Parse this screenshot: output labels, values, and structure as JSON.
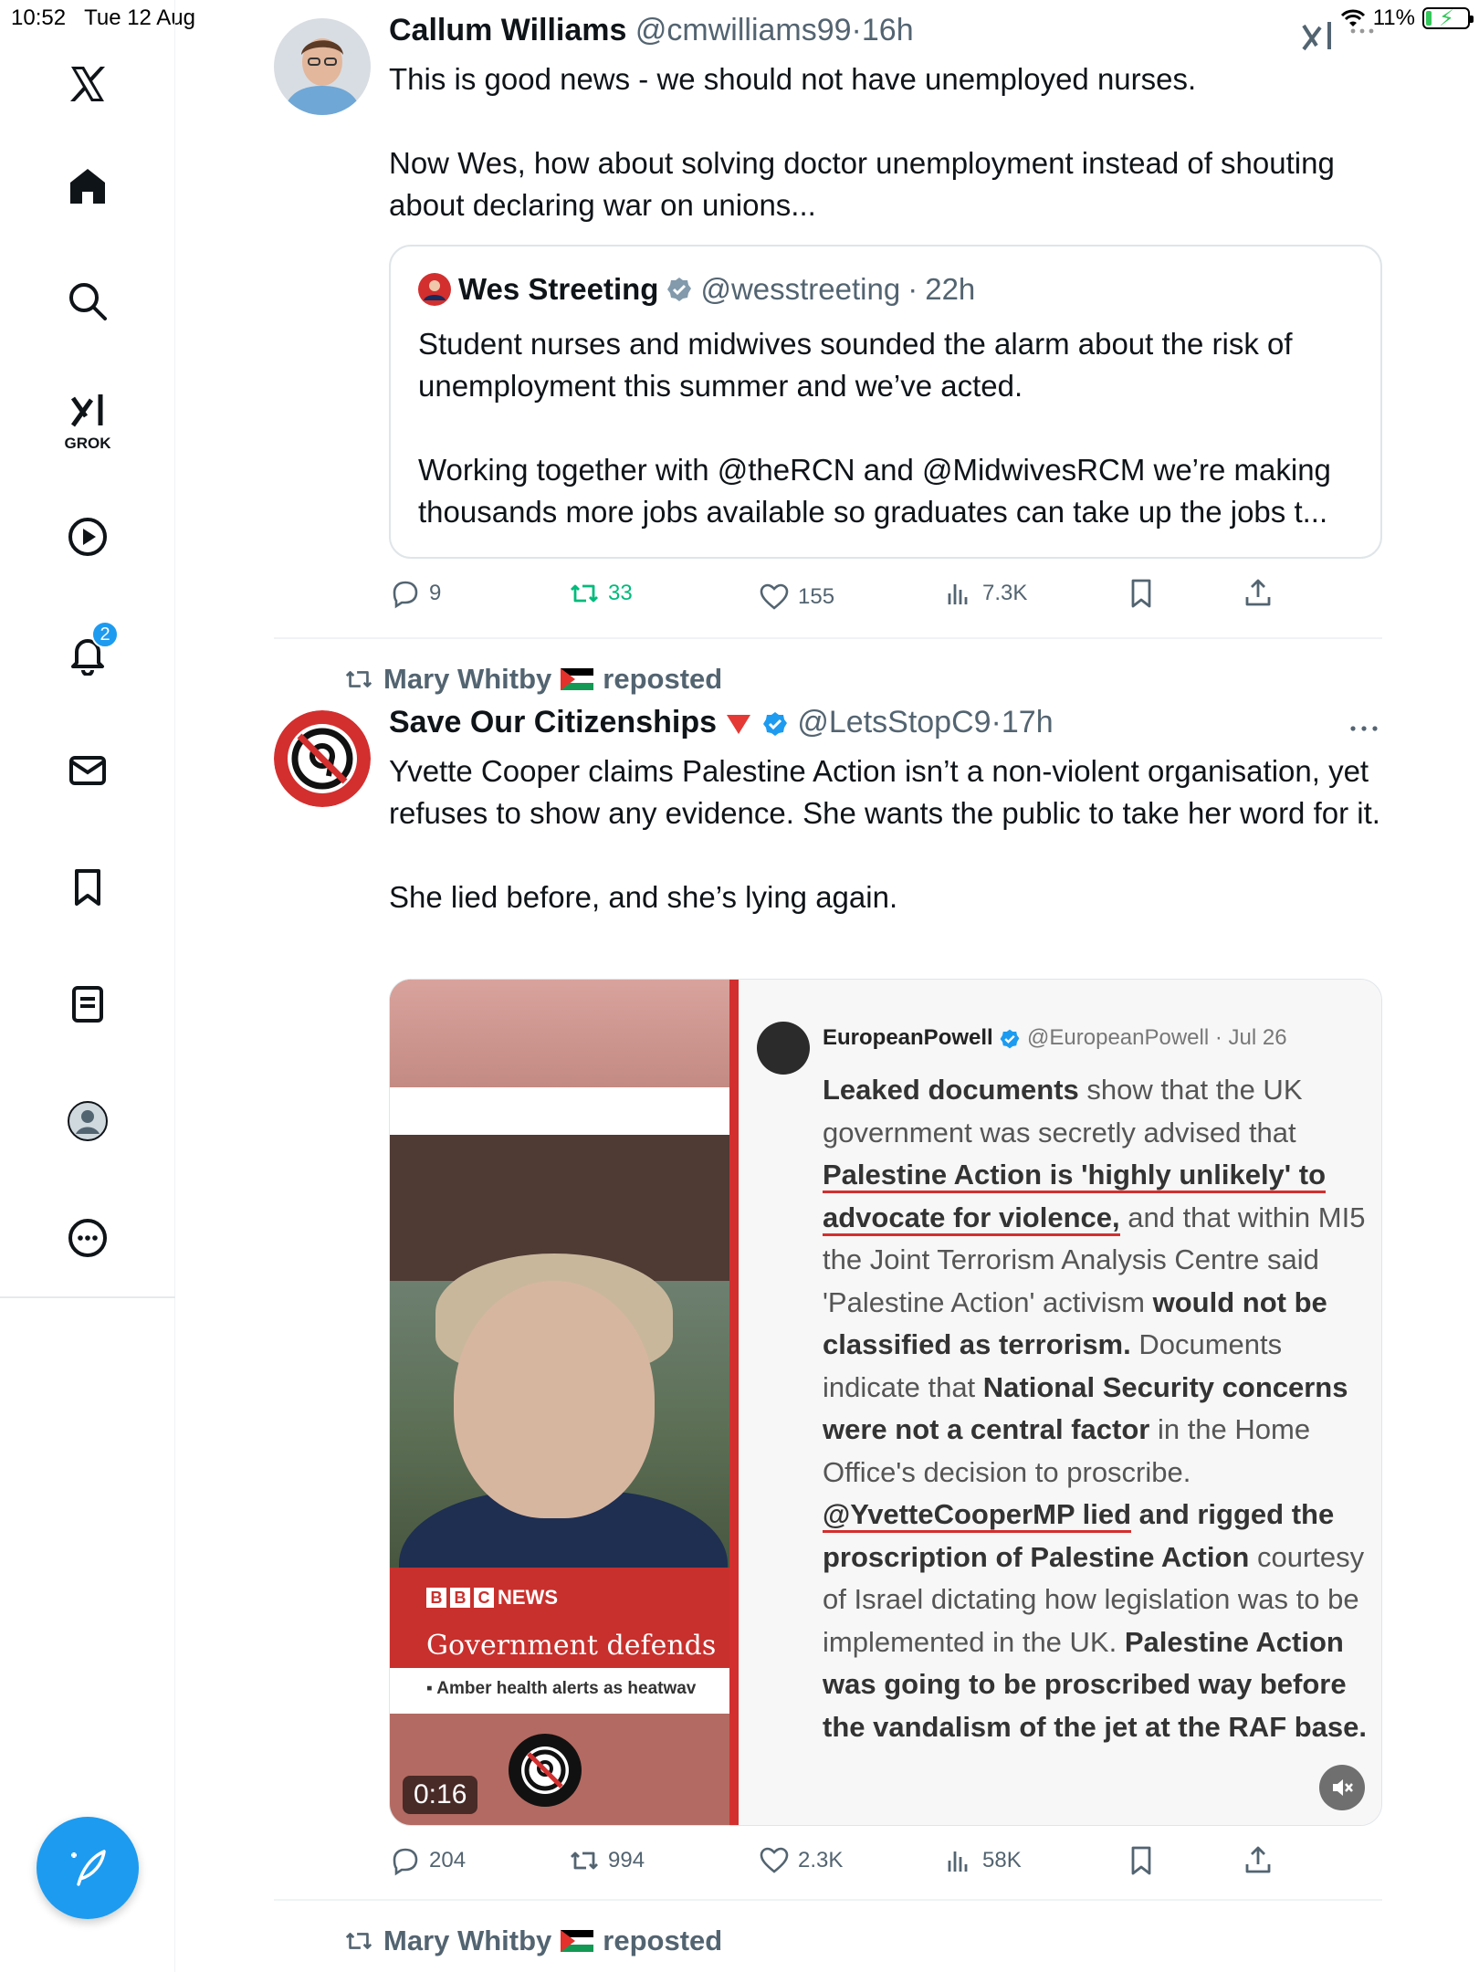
{
  "status": {
    "time": "10:52",
    "date": "Tue 12 Aug",
    "battery": "11%"
  },
  "nav": {
    "grok_label": "GROK",
    "notifications_badge": "2",
    "icons": [
      "x-logo-icon",
      "home-icon",
      "search-icon",
      "grok-icon",
      "video-icon",
      "notifications-icon",
      "messages-icon",
      "bookmarks-icon",
      "lists-icon",
      "profile-icon",
      "more-icon"
    ]
  },
  "tweet1": {
    "name": "Callum Williams",
    "handle": "@cmwilliams99",
    "time": "16h",
    "body": [
      "This is good news - we should not have unemployed nurses.",
      "Now Wes, how about solving doctor unemployment instead of shouting about declaring war on unions..."
    ],
    "quote": {
      "name": "Wes Streeting",
      "handle": "@wesstreeting",
      "time": "22h",
      "body": [
        "Student nurses and midwives sounded the alarm about the risk of unemployment this summer and we’ve acted.",
        "Working together with @theRCN and @MidwivesRCM we’re making thousands more jobs available so graduates can take up the jobs t..."
      ]
    },
    "stats": {
      "replies": "9",
      "reposts": "33",
      "likes": "155",
      "views": "7.3K"
    }
  },
  "tweet2": {
    "reposted_by": "Mary Whitby",
    "reposted_label": "reposted",
    "name": "Save Our Citizenships",
    "handle": "@LetsStopC9",
    "time": "17h",
    "body": [
      "Yvette Cooper claims Palestine Action isn’t a non-violent organisation, yet refuses to show any evidence. She wants the public to take her word for it.",
      "She lied before, and she’s lying again."
    ],
    "media": {
      "duration": "0:16",
      "news_brand": "NEWS",
      "news_headline": "Government defends",
      "news_ticker": "▪ Amber health alerts as heatwav",
      "embedded_name": "EuropeanPowell",
      "embedded_handle": "@EuropeanPowell",
      "embedded_time": "Jul 26",
      "embedded_segments": [
        {
          "t": "Leaked documents",
          "s": "b"
        },
        {
          "t": " show that the UK government was secretly advised that ",
          "s": ""
        },
        {
          "t": "Palestine Action is 'highly unlikely' to advocate for violence,",
          "s": "u"
        },
        {
          "t": " and that within MI5 the Joint Terrorism Analysis Centre said 'Palestine Action' activism ",
          "s": ""
        },
        {
          "t": "would not be classified as terrorism.",
          "s": "b"
        },
        {
          "t": " Documents indicate that ",
          "s": ""
        },
        {
          "t": "National Security concerns were not a central factor",
          "s": "b"
        },
        {
          "t": " in the Home Office's decision to proscribe. ",
          "s": ""
        },
        {
          "t": "@YvetteCooperMP lied",
          "s": "u"
        },
        {
          "t": " and rigged the proscription of Palestine Action",
          "s": "b"
        },
        {
          "t": " courtesy of Israel dictating how legislation was to be implemented in the UK. ",
          "s": ""
        },
        {
          "t": "Palestine Action was going to be proscribed way before the vandalism of the jet at the RAF base.",
          "s": "b"
        }
      ]
    },
    "stats": {
      "replies": "204",
      "reposts": "994",
      "likes": "2.3K",
      "views": "58K"
    }
  },
  "tweet3": {
    "reposted_by": "Mary Whitby",
    "reposted_label": "reposted"
  },
  "colors": {
    "accent": "#1d9bf0",
    "repost_green": "#00ba7c",
    "muted": "#536471",
    "underline_red": "#d32f2f"
  }
}
